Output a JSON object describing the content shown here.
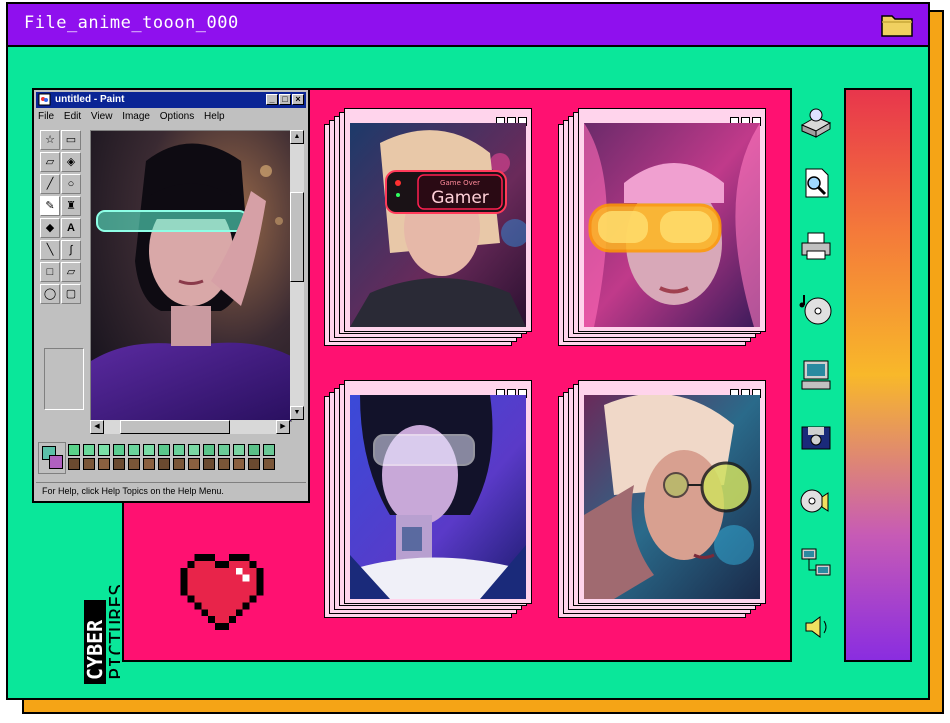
{
  "window": {
    "title": "File_anime_tooon_000",
    "accent": "#8f10ee",
    "background": "#0ae79a"
  },
  "paint": {
    "title": "untitled - Paint",
    "menus": [
      "File",
      "Edit",
      "View",
      "Image",
      "Options",
      "Help"
    ],
    "status": "For Help, click Help Topics on the Help Menu.",
    "window_buttons": [
      "_",
      "□",
      "×"
    ]
  },
  "photos": [
    {
      "name": "gamer-visor-photo",
      "visor_text_small": "Game Over",
      "visor_text": "Gamer"
    },
    {
      "name": "yellow-goggles-photo"
    },
    {
      "name": "clear-visor-photo"
    },
    {
      "name": "round-glasses-photo"
    }
  ],
  "side_icons": [
    "disk-drive-icon",
    "document-search-icon",
    "printer-icon",
    "music-cd-icon",
    "computer-icon",
    "camera-disk-icon",
    "cd-speaker-icon",
    "network-icon",
    "speaker-icon"
  ],
  "caption": {
    "line1": "CYBER",
    "line2": "PICTURES"
  },
  "colors": {
    "pink": "#ff1171",
    "orange": "#f5a416",
    "navy": "#0a2595"
  }
}
